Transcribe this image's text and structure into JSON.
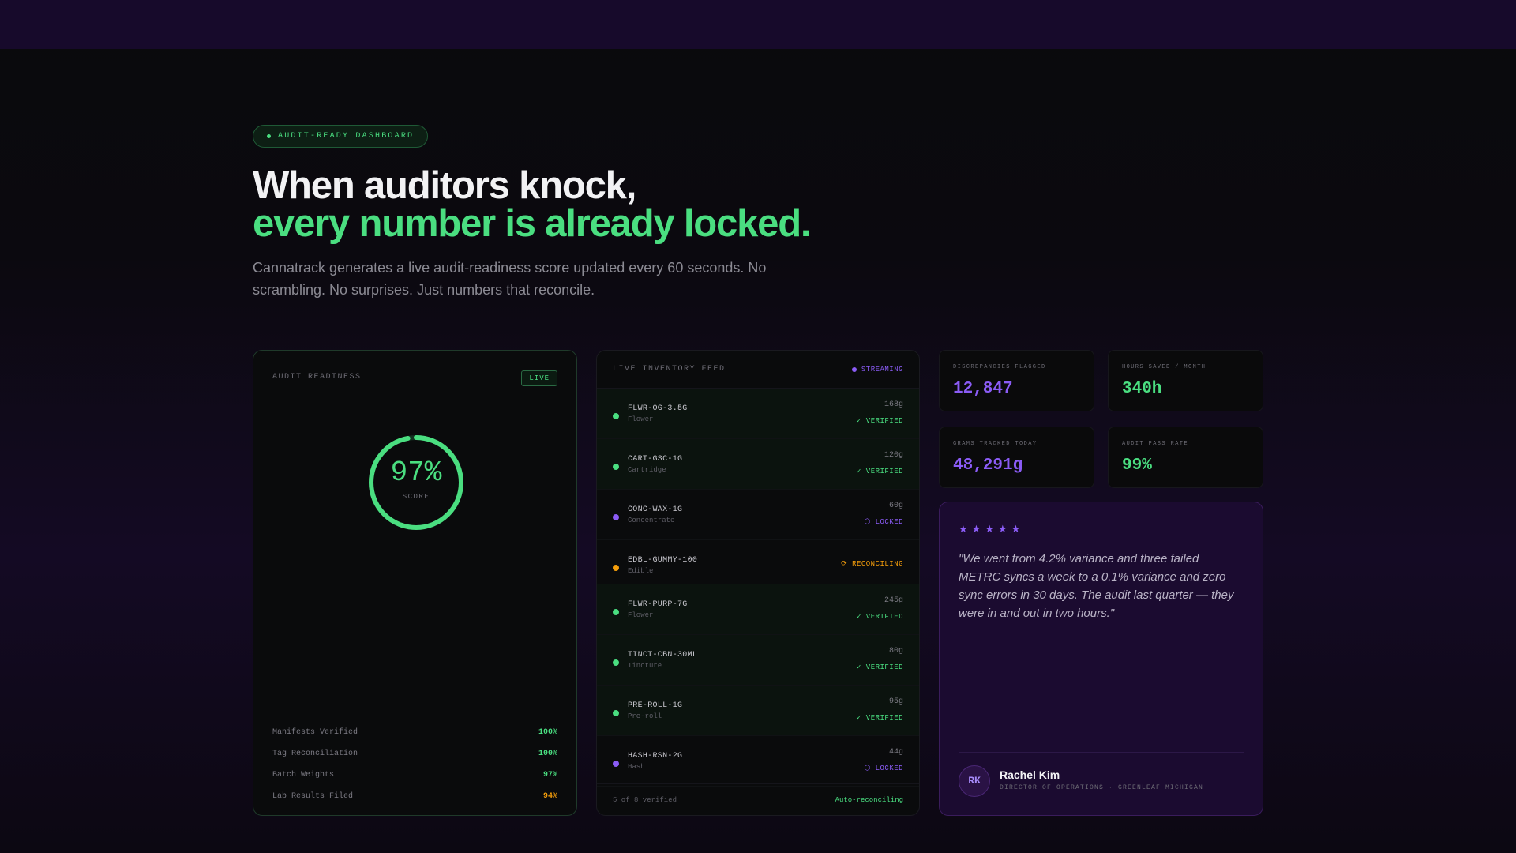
{
  "hero": {
    "badge": "AUDIT-READY DASHBOARD",
    "headline_1": "When auditors knock,",
    "headline_2": "every number is already locked.",
    "subtitle": "Cannatrack generates a live audit-readiness score updated every 60 seconds. No scrambling. No surprises. Just numbers that reconcile."
  },
  "audit": {
    "title": "AUDIT READINESS",
    "live_badge": "LIVE",
    "score_text": "97%",
    "score_fraction": 0.97,
    "score_label": "SCORE",
    "metrics": [
      {
        "label": "Manifests Verified",
        "value": "100%",
        "color": "#4ade80"
      },
      {
        "label": "Tag Reconciliation",
        "value": "100%",
        "color": "#4ade80"
      },
      {
        "label": "Batch Weights",
        "value": "97%",
        "color": "#4ade80"
      },
      {
        "label": "Lab Results Filed",
        "value": "94%",
        "color": "#f59e0b"
      }
    ]
  },
  "feed": {
    "title": "LIVE INVENTORY FEED",
    "status": "STREAMING",
    "rows": [
      {
        "sku": "FLWR-OG-3.5G",
        "category": "Flower",
        "grams": "168g",
        "status": "✓ VERIFIED",
        "state": "verified"
      },
      {
        "sku": "CART-GSC-1G",
        "category": "Cartridge",
        "grams": "120g",
        "status": "✓ VERIFIED",
        "state": "verified"
      },
      {
        "sku": "CONC-WAX-1G",
        "category": "Concentrate",
        "grams": "60g",
        "status": "⬡ LOCKED",
        "state": "locked"
      },
      {
        "sku": "EDBL-GUMMY-100",
        "category": "Edible",
        "grams": "",
        "status": "⟳ RECONCILING",
        "state": "reconciling"
      },
      {
        "sku": "FLWR-PURP-7G",
        "category": "Flower",
        "grams": "245g",
        "status": "✓ VERIFIED",
        "state": "verified"
      },
      {
        "sku": "TINCT-CBN-30ML",
        "category": "Tincture",
        "grams": "80g",
        "status": "✓ VERIFIED",
        "state": "verified"
      },
      {
        "sku": "PRE-ROLL-1G",
        "category": "Pre-roll",
        "grams": "95g",
        "status": "✓ VERIFIED",
        "state": "verified"
      },
      {
        "sku": "HASH-RSN-2G",
        "category": "Hash",
        "grams": "44g",
        "status": "⬡ LOCKED",
        "state": "locked"
      }
    ],
    "footer_left": "5 of 8 verified",
    "footer_right": "Auto-reconciling"
  },
  "stats": [
    {
      "label": "DISCREPANCIES FLAGGED",
      "value": "12,847",
      "color": "#8b5cf6"
    },
    {
      "label": "HOURS SAVED / MONTH",
      "value": "340h",
      "color": "#4ade80"
    },
    {
      "label": "GRAMS TRACKED TODAY",
      "value": "48,291g",
      "color": "#8b5cf6"
    },
    {
      "label": "AUDIT PASS RATE",
      "value": "99%",
      "color": "#4ade80"
    }
  ],
  "testimonial": {
    "rating": 5,
    "quote": "\"We went from 4.2% variance and three failed METRC syncs a week to a 0.1% variance and zero sync errors in 30 days. The audit last quarter — they were in and out in two hours.\"",
    "initials": "RK",
    "name": "Rachel Kim",
    "role": "DIRECTOR OF OPERATIONS · GREENLEAF MICHIGAN"
  },
  "colors": {
    "green": "#4ade80",
    "purple": "#8b5cf6",
    "amber": "#f59e0b"
  }
}
